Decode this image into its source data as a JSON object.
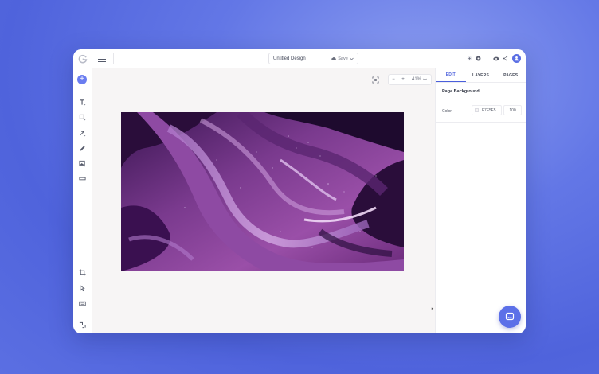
{
  "app": {
    "logo_letter": "G"
  },
  "topbar": {
    "design_title": "Untitled Design",
    "save_label": "Save"
  },
  "canvas": {
    "zoom_level": "41%",
    "zoom_minus": "−",
    "zoom_plus": "+"
  },
  "left_toolbar": {
    "add": "+",
    "tools": [
      "text-tool-icon",
      "shape-tool-icon",
      "arrow-tool-icon",
      "draw-tool-icon",
      "image-tool-icon",
      "line-tool-icon"
    ],
    "bottom_tools": [
      "crop-icon",
      "select-icon",
      "keyboard-icon",
      "settings-icon"
    ]
  },
  "right_panel": {
    "tabs": [
      {
        "label": "EDIT",
        "active": true
      },
      {
        "label": "LAYERS",
        "active": false
      },
      {
        "label": "PAGES",
        "active": false
      }
    ],
    "section_title": "Page Background",
    "color_label": "Color",
    "color_value": "F7F5F5",
    "opacity_value": "100"
  },
  "colors": {
    "accent": "#4a5fdc",
    "chat_button": "#5c70e8",
    "canvas_bg": "#f7f5f5"
  }
}
